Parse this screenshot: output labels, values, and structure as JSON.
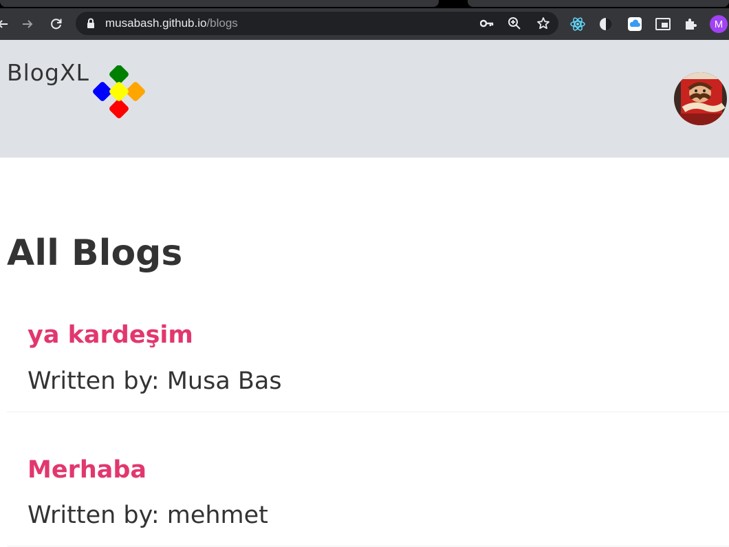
{
  "browser": {
    "url_host": "musabash.github.io",
    "url_path": "/blogs",
    "profile_initial": "M",
    "icons": {
      "back": "arrow-left-icon",
      "forward": "arrow-right-icon",
      "reload": "reload-icon",
      "lock": "lock-icon",
      "key": "key-icon",
      "zoom": "zoom-icon",
      "bookmark": "star-icon",
      "extensions": [
        "react-devtools-icon",
        "dark-reader-icon",
        "icloud-icon",
        "picture-in-picture-icon",
        "puzzle-icon"
      ]
    }
  },
  "header": {
    "logo_text": "BlogXL",
    "logo_colors": [
      "#008000",
      "#0000ff",
      "#ffff00",
      "#ffa500",
      "#ff0000"
    ],
    "avatar": "pringles-avatar"
  },
  "main": {
    "title": "All Blogs",
    "blogs": [
      {
        "title": "ya kardeşim",
        "author": "Written by: Musa Bas"
      },
      {
        "title": "Merhaba",
        "author": "Written by: mehmet"
      }
    ]
  },
  "colors": {
    "header_bg": "#dee2e6",
    "blog_title": "#e2376e",
    "text": "#333333"
  }
}
